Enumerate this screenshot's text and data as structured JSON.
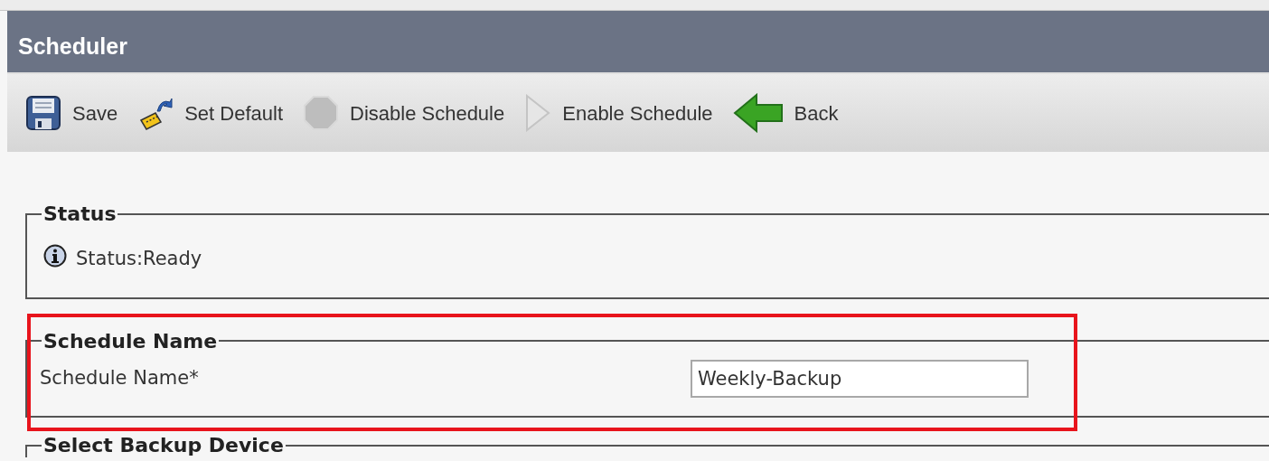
{
  "window": {
    "title": "Scheduler"
  },
  "toolbar": [
    {
      "kind": "save",
      "label": "Save"
    },
    {
      "kind": "default",
      "label": "Set Default"
    },
    {
      "kind": "disable",
      "label": "Disable Schedule"
    },
    {
      "kind": "enable",
      "label": "Enable Schedule"
    },
    {
      "kind": "back",
      "label": "Back"
    }
  ],
  "status": {
    "legend": "Status",
    "message": "Status:Ready"
  },
  "schedule_name": {
    "legend": "Schedule Name",
    "label": "Schedule Name*",
    "value": "Weekly-Backup",
    "highlighted": true
  },
  "next_section": {
    "legend": "Select Backup Device"
  }
}
